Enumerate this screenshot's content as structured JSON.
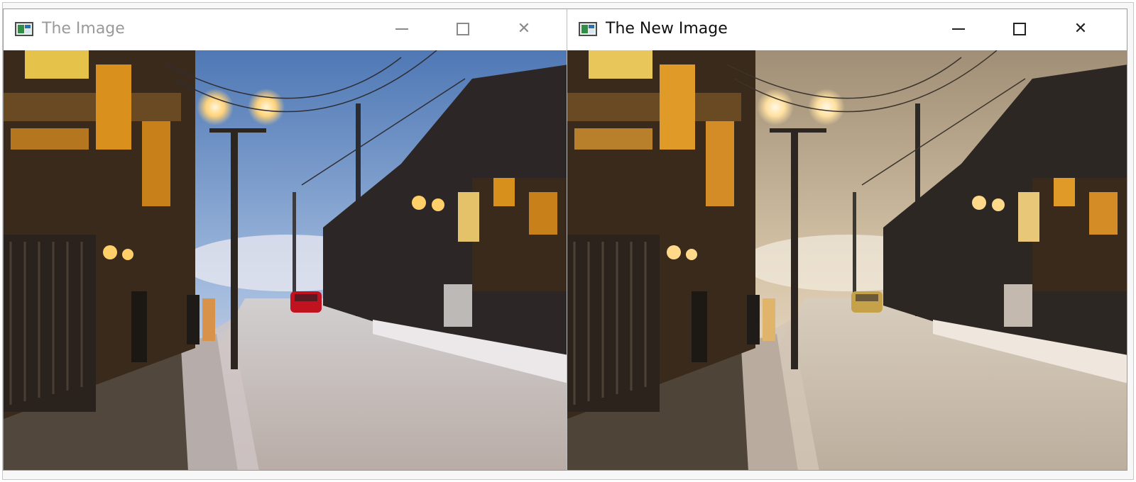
{
  "windows": [
    {
      "title": "The Image",
      "state": "inactive",
      "icon": "app-image-icon",
      "controls": {
        "minimize": "minimize-icon",
        "maximize": "maximize-icon",
        "close": "close-icon"
      },
      "image": {
        "description_tag": "original-photo",
        "tint": "#9ec3e6"
      }
    },
    {
      "title": "The New Image",
      "state": "active",
      "icon": "app-image-icon",
      "controls": {
        "minimize": "minimize-icon",
        "maximize": "maximize-icon",
        "close": "close-icon"
      },
      "image": {
        "description_tag": "processed-photo",
        "tint": "#e9d2b0"
      }
    }
  ],
  "glyphs": {
    "close": "✕"
  }
}
